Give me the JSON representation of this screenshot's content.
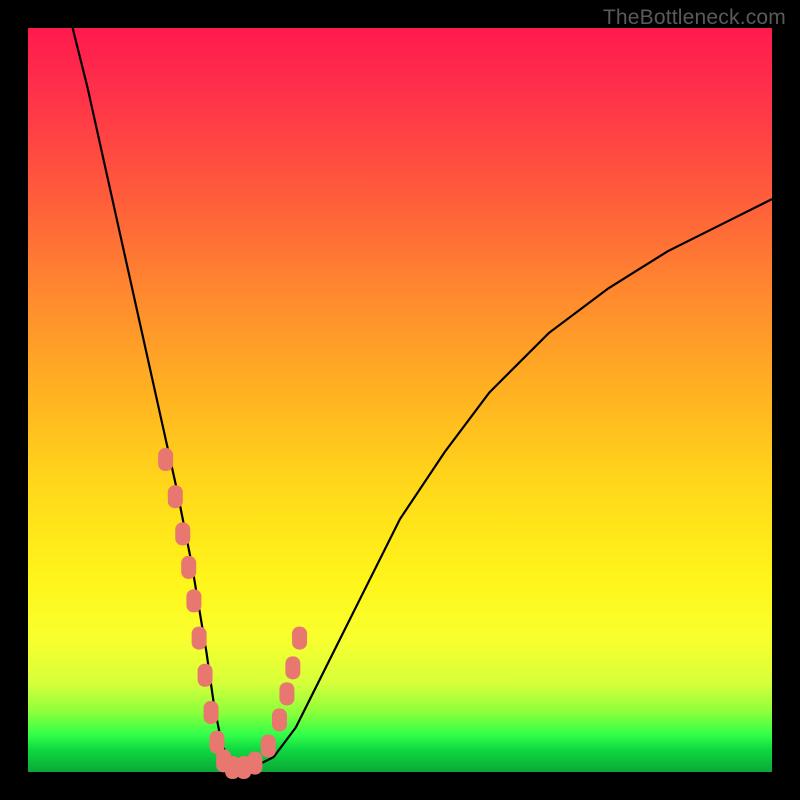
{
  "watermark": "TheBottleneck.com",
  "colors": {
    "marker": "#e8776f",
    "curve": "#000000"
  },
  "chart_data": {
    "type": "line",
    "title": "",
    "xlabel": "",
    "ylabel": "",
    "xlim": [
      0,
      100
    ],
    "ylim": [
      0,
      100
    ],
    "grid": false,
    "series": [
      {
        "name": "bottleneck-curve",
        "x": [
          6,
          8,
          10,
          12,
          14,
          16,
          18,
          20,
          22,
          23,
          24,
          25,
          26,
          27,
          28,
          30,
          33,
          36,
          40,
          45,
          50,
          56,
          62,
          70,
          78,
          86,
          94,
          100
        ],
        "y": [
          100,
          92,
          83,
          74,
          65,
          56,
          47,
          38,
          28,
          22,
          16,
          9,
          4,
          1.5,
          0.5,
          0.5,
          2,
          6,
          14,
          24,
          34,
          43,
          51,
          59,
          65,
          70,
          74,
          77
        ]
      }
    ],
    "markers": {
      "name": "highlight-points",
      "x": [
        18.5,
        19.8,
        20.8,
        21.6,
        22.3,
        23.0,
        23.8,
        24.6,
        25.4,
        26.3,
        27.5,
        29.0,
        30.5,
        32.3,
        33.8,
        34.8,
        35.6,
        36.5
      ],
      "y": [
        42,
        37,
        32,
        27.5,
        23,
        18,
        13,
        8,
        4,
        1.5,
        0.6,
        0.6,
        1.2,
        3.5,
        7,
        10.5,
        14,
        18
      ]
    }
  }
}
